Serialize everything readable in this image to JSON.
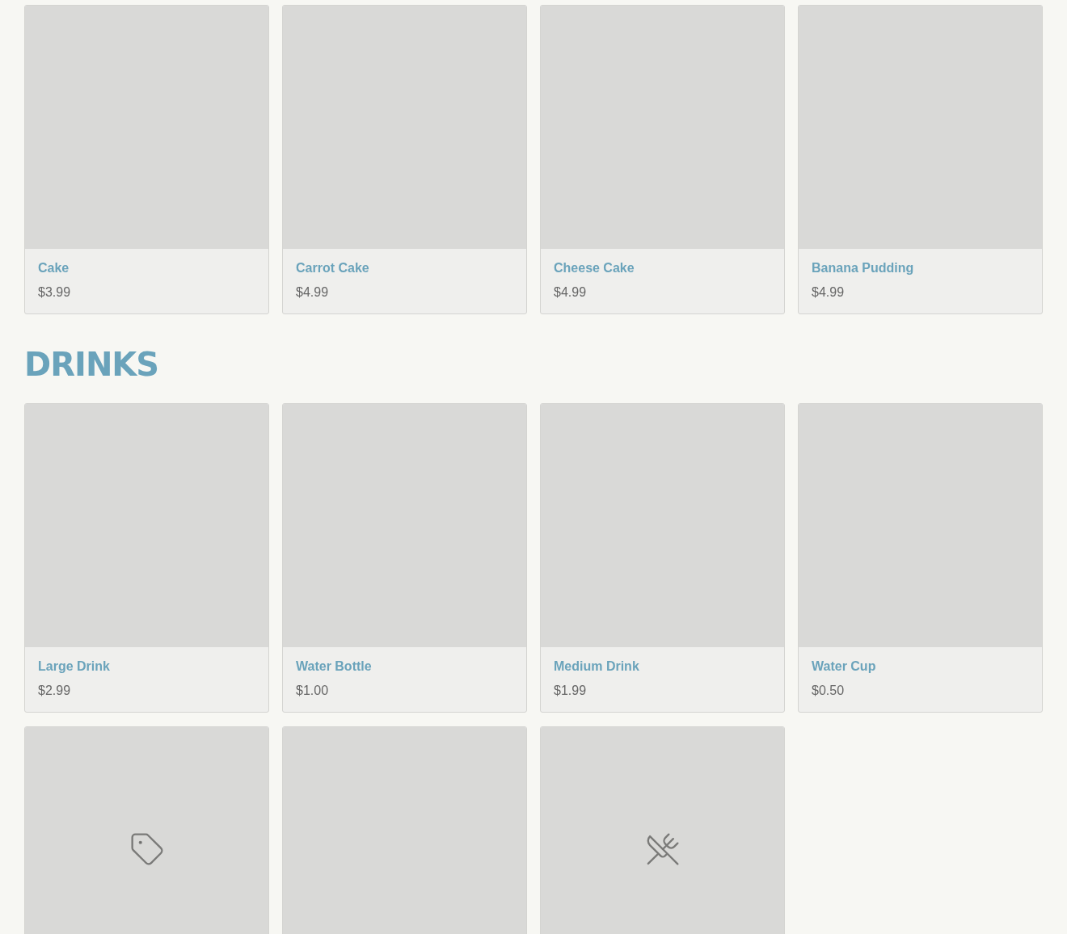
{
  "sections": [
    {
      "items": [
        {
          "kind": "product",
          "name": "Cake",
          "price": "$3.99"
        },
        {
          "kind": "product",
          "name": "Carrot Cake",
          "price": "$4.99"
        },
        {
          "kind": "product",
          "name": "Cheese Cake",
          "price": "$4.99"
        },
        {
          "kind": "product",
          "name": "Banana Pudding",
          "price": "$4.99"
        }
      ]
    },
    {
      "title": "DRINKS",
      "items": [
        {
          "kind": "product",
          "name": "Large Drink",
          "price": "$2.99"
        },
        {
          "kind": "product",
          "name": "Water Bottle",
          "price": "$1.00"
        },
        {
          "kind": "product",
          "name": "Medium Drink",
          "price": "$1.99"
        },
        {
          "kind": "product",
          "name": "Water Cup",
          "price": "$0.50"
        },
        {
          "kind": "tag"
        },
        {
          "kind": "plain"
        },
        {
          "kind": "dish"
        }
      ]
    }
  ]
}
